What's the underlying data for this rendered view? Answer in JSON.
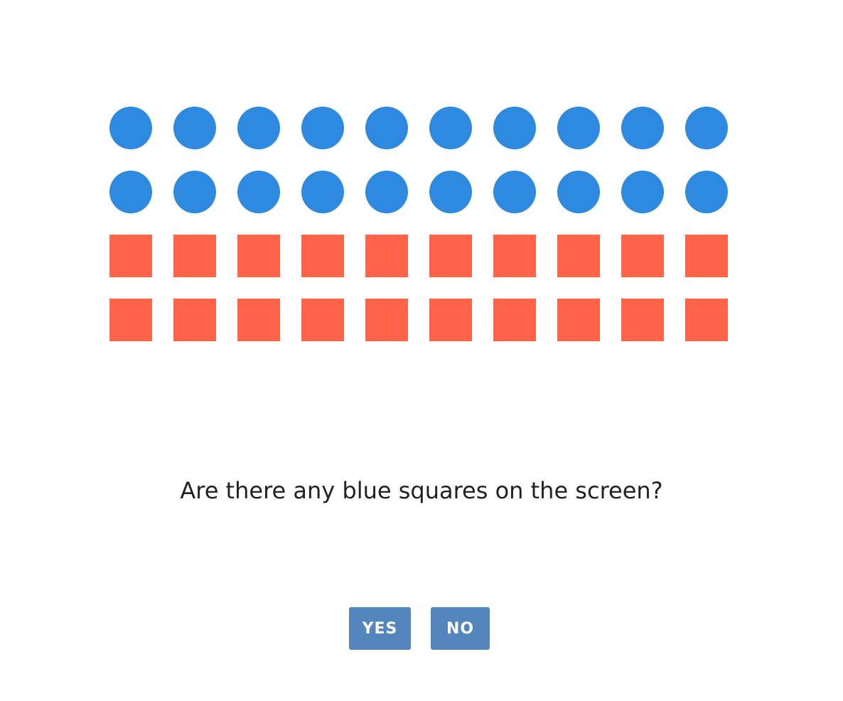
{
  "colors": {
    "circle": "#2E89E0",
    "square": "#FF634A",
    "button_bg": "#5286BD",
    "button_text": "#FFFFFF",
    "question_text": "#222222"
  },
  "stimulus": {
    "rows": [
      {
        "shape": "circle",
        "color": "blue",
        "count": 10
      },
      {
        "shape": "circle",
        "color": "blue",
        "count": 10
      },
      {
        "shape": "square",
        "color": "red",
        "count": 10
      },
      {
        "shape": "square",
        "color": "red",
        "count": 10
      }
    ]
  },
  "question": "Are there any blue squares on the screen?",
  "buttons": {
    "yes_label": "YES",
    "no_label": "NO"
  }
}
